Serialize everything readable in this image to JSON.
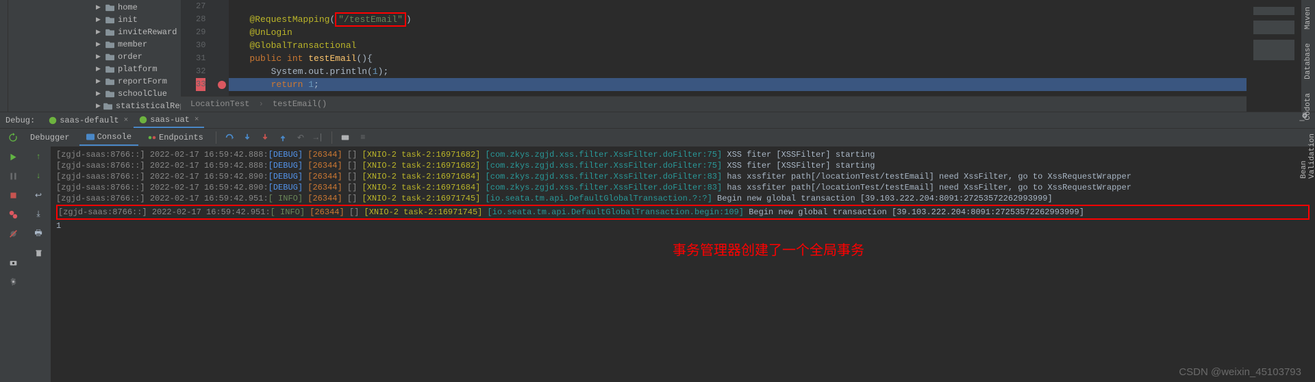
{
  "projectTree": [
    "home",
    "init",
    "inviteReward",
    "member",
    "order",
    "platform",
    "reportForm",
    "schoolClue",
    "statisticalReport"
  ],
  "editor": {
    "lines": [
      {
        "num": 27,
        "code": {
          "segments": []
        }
      },
      {
        "num": 28,
        "code": {
          "segments": [
            {
              "txt": "@RequestMapping",
              "cls": "k-annotation"
            },
            {
              "txt": "(",
              "cls": ""
            },
            {
              "txt": "\"/testEmail\"",
              "cls": "k-string",
              "boxed": true
            },
            {
              "txt": ")",
              "cls": ""
            }
          ]
        }
      },
      {
        "num": 29,
        "code": {
          "segments": [
            {
              "txt": "@UnLogin",
              "cls": "k-annotation"
            }
          ]
        }
      },
      {
        "num": 30,
        "code": {
          "segments": [
            {
              "txt": "@GlobalTransactional",
              "cls": "k-annotation"
            }
          ]
        }
      },
      {
        "num": 31,
        "code": {
          "segments": [
            {
              "txt": "public int ",
              "cls": "k-keyword"
            },
            {
              "txt": "testEmail",
              "cls": "k-method"
            },
            {
              "txt": "(){",
              "cls": ""
            }
          ]
        }
      },
      {
        "num": 32,
        "code": {
          "segments": [
            {
              "txt": "    System.out.",
              "cls": ""
            },
            {
              "txt": "println",
              "cls": ""
            },
            {
              "txt": "(",
              "cls": ""
            },
            {
              "txt": "1",
              "cls": "k-num"
            },
            {
              "txt": ");",
              "cls": ""
            }
          ]
        }
      },
      {
        "num": 33,
        "code": {
          "hl": true,
          "bp": true,
          "segments": [
            {
              "txt": "    ",
              "cls": ""
            },
            {
              "txt": "return ",
              "cls": "k-keyword"
            },
            {
              "txt": "1",
              "cls": "k-num"
            },
            {
              "txt": ";",
              "cls": ""
            }
          ]
        }
      }
    ],
    "breadcrumb": {
      "parent": "LocationTest",
      "method": "testEmail()"
    }
  },
  "debug": {
    "title": "Debug:",
    "tabs": [
      {
        "name": "saas-default",
        "active": false
      },
      {
        "name": "saas-uat",
        "active": true
      }
    ],
    "subTabs": {
      "debugger": "Debugger",
      "console": "Console",
      "endpoints": "Endpoints"
    }
  },
  "console": {
    "lines": [
      {
        "ts": "[zgjd-saas:8766::] 2022-02-17 16:59:42.888:",
        "lvl": "DEBUG",
        "pid": "[26344]",
        "br": "[]",
        "thread": "[XNIO-2 task-2:16971682]",
        "cls": "[com.zkys.zgjd.xss.filter.XssFilter.doFilter:75]",
        "msg": "XSS fiter [XSSFilter] starting"
      },
      {
        "ts": "[zgjd-saas:8766::] 2022-02-17 16:59:42.888:",
        "lvl": "DEBUG",
        "pid": "[26344]",
        "br": "[]",
        "thread": "[XNIO-2 task-2:16971682]",
        "cls": "[com.zkys.zgjd.xss.filter.XssFilter.doFilter:75]",
        "msg": "XSS fiter [XSSFilter] starting"
      },
      {
        "ts": "[zgjd-saas:8766::] 2022-02-17 16:59:42.890:",
        "lvl": "DEBUG",
        "pid": "[26344]",
        "br": "[]",
        "thread": "[XNIO-2 task-2:16971684]",
        "cls": "[com.zkys.zgjd.xss.filter.XssFilter.doFilter:83]",
        "msg": "has xssfiter path[/locationTest/testEmail] need XssFilter, go to XssRequestWrapper"
      },
      {
        "ts": "[zgjd-saas:8766::] 2022-02-17 16:59:42.890:",
        "lvl": "DEBUG",
        "pid": "[26344]",
        "br": "[]",
        "thread": "[XNIO-2 task-2:16971684]",
        "cls": "[com.zkys.zgjd.xss.filter.XssFilter.doFilter:83]",
        "msg": "has xssfiter path[/locationTest/testEmail] need XssFilter, go to XssRequestWrapper"
      },
      {
        "ts": "[zgjd-saas:8766::] 2022-02-17 16:59:42.951:",
        "lvl": "INFO",
        "pid": "[26344]",
        "br": "[]",
        "thread": "[XNIO-2 task-2:16971745]",
        "cls": "[io.seata.tm.api.DefaultGlobalTransaction.?:?]",
        "msg": "Begin new global transaction [39.103.222.204:8091:27253572262993999]"
      },
      {
        "ts": "[zgjd-saas:8766::] 2022-02-17 16:59:42.951:",
        "lvl": "INFO",
        "pid": "[26344]",
        "br": "[]",
        "thread": "[XNIO-2 task-2:16971745]",
        "cls": "[io.seata.tm.api.DefaultGlobalTransaction.begin:109]",
        "msg": "Begin new global transaction [39.103.222.204:8091:27253572262993999]",
        "highlighted": true
      }
    ],
    "finalOutput": "1",
    "annotation": "事务管理器创建了一个全局事务"
  },
  "rightSidebar": [
    "Maven",
    "Database",
    "Codota",
    "Bean Validation"
  ],
  "watermark": "CSDN @weixin_45103793"
}
